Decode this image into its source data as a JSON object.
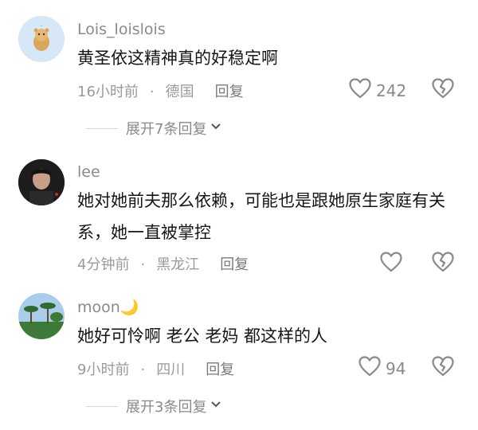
{
  "comments": [
    {
      "username": "Lois_loislois",
      "text": "黄圣依这精神真的好稳定啊",
      "time": "16小时前",
      "location": "德国",
      "reply_label": "回复",
      "likes": "242",
      "expand_label": "展开7条回复"
    },
    {
      "username": "lee",
      "text": "她对她前夫那么依赖，可能也是跟她原生家庭有关系，她一直被掌控",
      "time": "4分钟前",
      "location": "黑龙江",
      "reply_label": "回复",
      "likes": ""
    },
    {
      "username": "moon🌙",
      "text": "她好可怜啊 老公 老妈 都这样的人",
      "time": "9小时前",
      "location": "四川",
      "reply_label": "回复",
      "likes": "94",
      "expand_label": "展开3条回复"
    }
  ],
  "icons": {
    "like": "heart-outline-icon",
    "dislike": "broken-heart-icon",
    "expand": "chevron-down-icon"
  },
  "colors": {
    "text": "#161616",
    "meta": "#9a9a9a",
    "icon": "#8a8a8a"
  }
}
